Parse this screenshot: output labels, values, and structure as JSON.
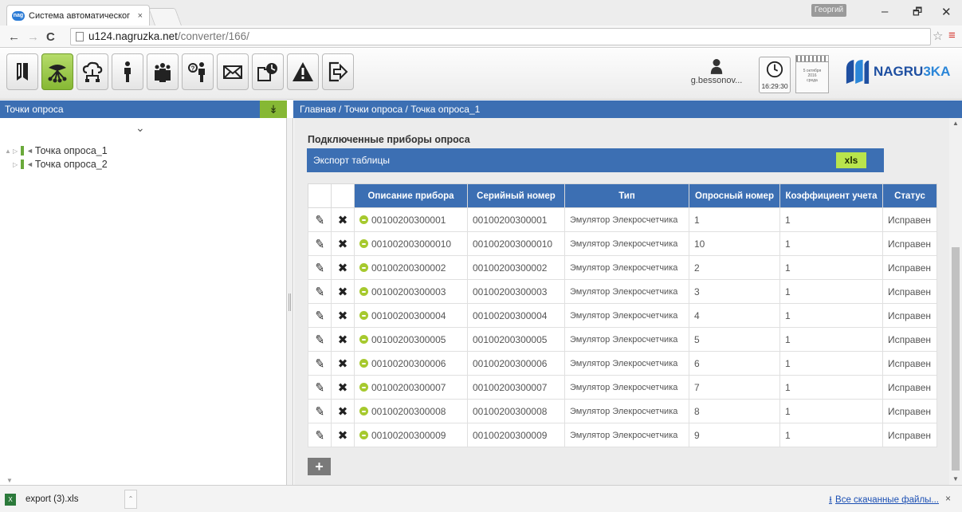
{
  "browser": {
    "tab_title": "Система автоматическог",
    "tab_favicon_text": "nag",
    "tab_close": "×",
    "profile_name": "Георгий",
    "url_host": "u124.nagruzka.net",
    "url_path": "/converter/166/",
    "window_controls": {
      "minimize": "–",
      "restore": "🗗",
      "close": "✕"
    }
  },
  "toolbar": {
    "buttons": [
      {
        "icon": "book-icon"
      },
      {
        "icon": "network-icon",
        "active": true
      },
      {
        "icon": "cloud-network-icon"
      },
      {
        "icon": "person-icon"
      },
      {
        "icon": "people-group-icon"
      },
      {
        "icon": "help-person-icon"
      },
      {
        "icon": "envelope-icon"
      },
      {
        "icon": "schedule-icon"
      },
      {
        "icon": "warning-icon"
      },
      {
        "icon": "logout-icon"
      }
    ],
    "user_name": "g.bessonov...",
    "clock_time": "16:29:30",
    "calendar_lines": [
      "5 октября",
      "2016",
      "среда"
    ],
    "logo_text_main": "NAGRU",
    "logo_text_accent": "3KA"
  },
  "left_panel": {
    "title": "Точки опроса",
    "pin_icon": "↡",
    "tree": [
      {
        "label": "Точка опроса_1",
        "expanded": true
      },
      {
        "label": "Точка опроса_2",
        "expanded": false
      }
    ]
  },
  "breadcrumb": "Главная  /  Точки опроса  /  Точка опроса_1",
  "main": {
    "section_title": "Подключенные приборы опроса",
    "export_label": "Экспорт таблицы",
    "xls_button": "xls",
    "columns": [
      "Описание прибора",
      "Серийный номер",
      "Тип",
      "Опросный номер",
      "Коэффициент учета",
      "Статус"
    ],
    "rows": [
      [
        "00100200300001",
        "00100200300001",
        "Эмулятор Элекросчетчика",
        "1",
        "1",
        "Исправен"
      ],
      [
        "001002003000010",
        "001002003000010",
        "Эмулятор Элекросчетчика",
        "10",
        "1",
        "Исправен"
      ],
      [
        "00100200300002",
        "00100200300002",
        "Эмулятор Элекросчетчика",
        "2",
        "1",
        "Исправен"
      ],
      [
        "00100200300003",
        "00100200300003",
        "Эмулятор Элекросчетчика",
        "3",
        "1",
        "Исправен"
      ],
      [
        "00100200300004",
        "00100200300004",
        "Эмулятор Элекросчетчика",
        "4",
        "1",
        "Исправен"
      ],
      [
        "00100200300005",
        "00100200300005",
        "Эмулятор Элекросчетчика",
        "5",
        "1",
        "Исправен"
      ],
      [
        "00100200300006",
        "00100200300006",
        "Эмулятор Элекросчетчика",
        "6",
        "1",
        "Исправен"
      ],
      [
        "00100200300007",
        "00100200300007",
        "Эмулятор Элекросчетчика",
        "7",
        "1",
        "Исправен"
      ],
      [
        "00100200300008",
        "00100200300008",
        "Эмулятор Элекросчетчика",
        "8",
        "1",
        "Исправен"
      ],
      [
        "00100200300009",
        "00100200300009",
        "Эмулятор Элекросчетчика",
        "9",
        "1",
        "Исправен"
      ]
    ],
    "add_button": "+"
  },
  "downloads": {
    "file_name": "export (3).xls",
    "all_downloads": "Все скачанные файлы...",
    "close": "×"
  },
  "colors": {
    "header_blue": "#3c6fb3",
    "active_green": "#86b834",
    "xls_green": "#b9e44c",
    "status_ok": "#a6c92e"
  }
}
